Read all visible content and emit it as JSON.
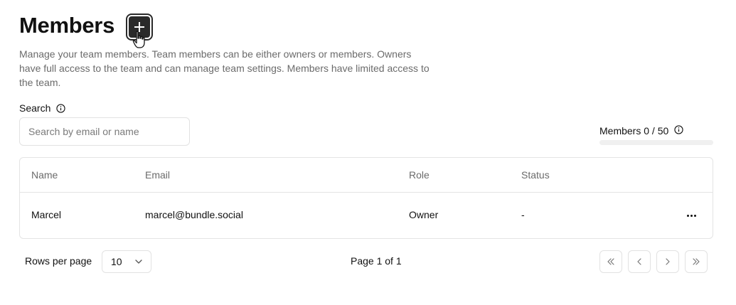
{
  "header": {
    "title": "Members",
    "add_button_icon": "plus-icon",
    "description": "Manage your team members. Team members can be either owners or members. Owners have full access to the team and can manage team settings. Members have limited access to the team."
  },
  "search": {
    "label": "Search",
    "placeholder": "Search by email or name",
    "value": ""
  },
  "members_count": {
    "label": "Members 0 / 50",
    "progress_fraction": 0
  },
  "table": {
    "columns": [
      "Name",
      "Email",
      "Role",
      "Status"
    ],
    "rows": [
      {
        "name": "Marcel",
        "email": "marcel@bundle.social",
        "role": "Owner",
        "status": "-"
      }
    ]
  },
  "pagination": {
    "rows_per_page_label": "Rows per page",
    "rows_per_page_value": "10",
    "page_info": "Page 1 of 1"
  },
  "colors": {
    "primary_button": "#2a2a2a",
    "muted_text": "#6b6b6b",
    "border": "#e4e4e4"
  }
}
